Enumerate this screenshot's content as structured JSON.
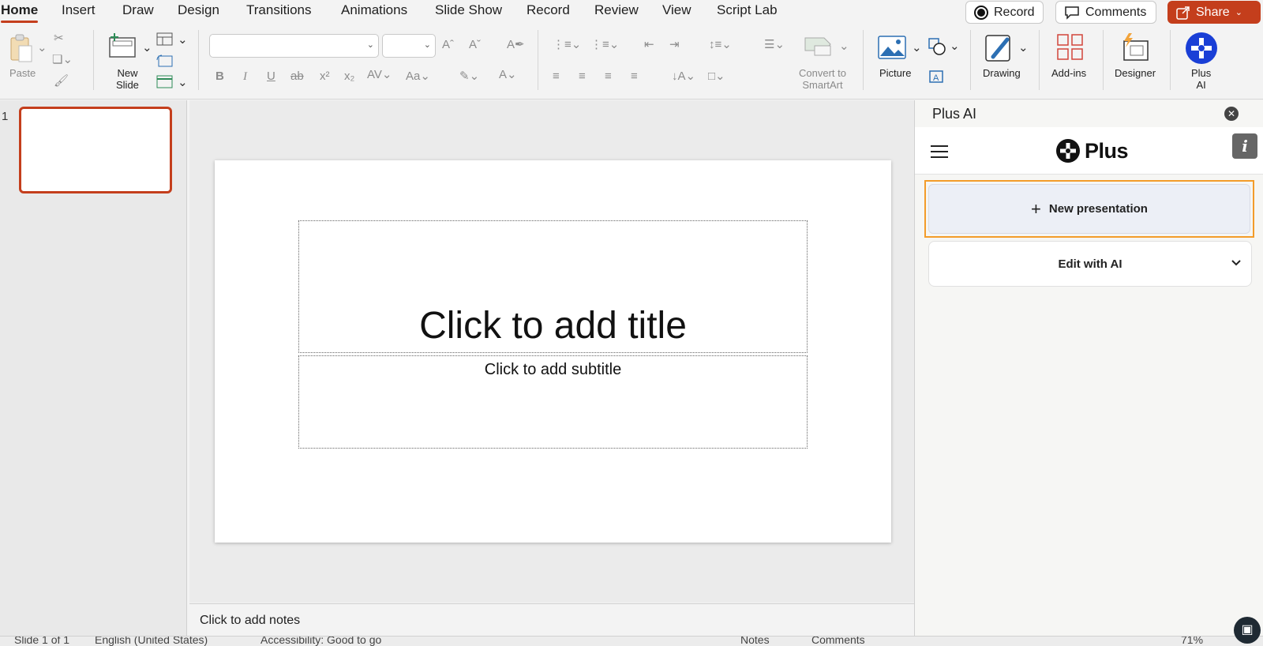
{
  "tabs": [
    "Home",
    "Insert",
    "Draw",
    "Design",
    "Transitions",
    "Animations",
    "Slide Show",
    "Record",
    "Review",
    "View",
    "Script Lab"
  ],
  "top_buttons": {
    "record": "Record",
    "comments": "Comments",
    "share": "Share"
  },
  "ribbon": {
    "paste": "Paste",
    "new_slide_line1": "New",
    "new_slide_line2": "Slide",
    "convert_line1": "Convert to",
    "convert_line2": "SmartArt",
    "picture": "Picture",
    "drawing": "Drawing",
    "addins": "Add-ins",
    "designer": "Designer",
    "plusai_line1": "Plus",
    "plusai_line2": "AI",
    "font_name": "",
    "font_size": ""
  },
  "thumbnails": {
    "slide_number": "1"
  },
  "slide": {
    "title_placeholder": "Click to add title",
    "subtitle_placeholder": "Click to add subtitle"
  },
  "notes_placeholder": "Click to add notes",
  "ai_pane": {
    "title": "Plus AI",
    "brand": "Plus",
    "new_presentation": "New presentation",
    "edit_with_ai": "Edit with AI"
  },
  "status": {
    "slide_of": "Slide 1 of 1",
    "language": "English (United States)",
    "accessibility": "Accessibility: Good to go",
    "notes": "Notes",
    "comments": "Comments",
    "zoom": "71%"
  },
  "colors": {
    "accent": "#c43e1c",
    "highlight": "#f39c2a",
    "plus_ai_blue": "#1a3fd6"
  }
}
